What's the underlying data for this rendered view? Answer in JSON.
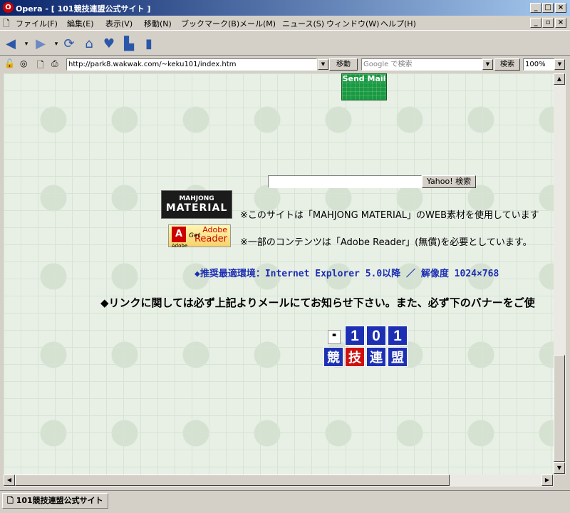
{
  "window": {
    "title": "Opera - [ 101競技連盟公式サイト ]",
    "app_icon": "opera-logo-icon"
  },
  "menu": [
    "ファイル(F)",
    "編集(E)",
    "表示(V)",
    "移動(N)",
    "ブックマーク(B)",
    "メール(M)",
    "ニュース(S)",
    "ウィンドウ(W)",
    "ヘルプ(H)"
  ],
  "toolbar": {
    "icons": [
      "back-icon",
      "forward-icon",
      "reload-icon",
      "home-icon",
      "hotlist-icon",
      "print-icon",
      "page-icon"
    ]
  },
  "address": {
    "url": "http://park8.wakwak.com/~keku101/index.htm",
    "go_label": "移動"
  },
  "search": {
    "placeholder": "Google で検索",
    "button_label": "検索"
  },
  "zoom": {
    "value": "100%"
  },
  "content": {
    "send_mail": "Send Mail",
    "yahoo_button": "Yahoo! 検索",
    "mahjong_logo": {
      "line1": "MAHJONG",
      "line2": "MATERIAL"
    },
    "mahjong_notice": "※このサイトは「MAHJONG MATERIAL」のWEB素材を使用しています",
    "adobe_logo": {
      "get": "Get",
      "line1": "Adobe",
      "line2": "Reader",
      "small": "Adobe"
    },
    "adobe_notice": "※一部のコンテンツは「Adobe Reader」(無償)を必要としています。",
    "env": "◆推奨最適環境：Internet Explorer 5.0以降 ／ 解像度 1024×768",
    "link_notice": "◆リンクに関しては必ず上記よりメールにてお知らせ下さい。また、必ず下のバナーをご使",
    "banner": {
      "digits": [
        "1",
        "0",
        "1"
      ],
      "kanji": [
        "競",
        "技",
        "連",
        "盟"
      ],
      "colors": {
        "blue": "#1d2fb3",
        "red": "#d01010"
      }
    }
  },
  "status": {
    "tab_label": "101競技連盟公式サイト"
  }
}
